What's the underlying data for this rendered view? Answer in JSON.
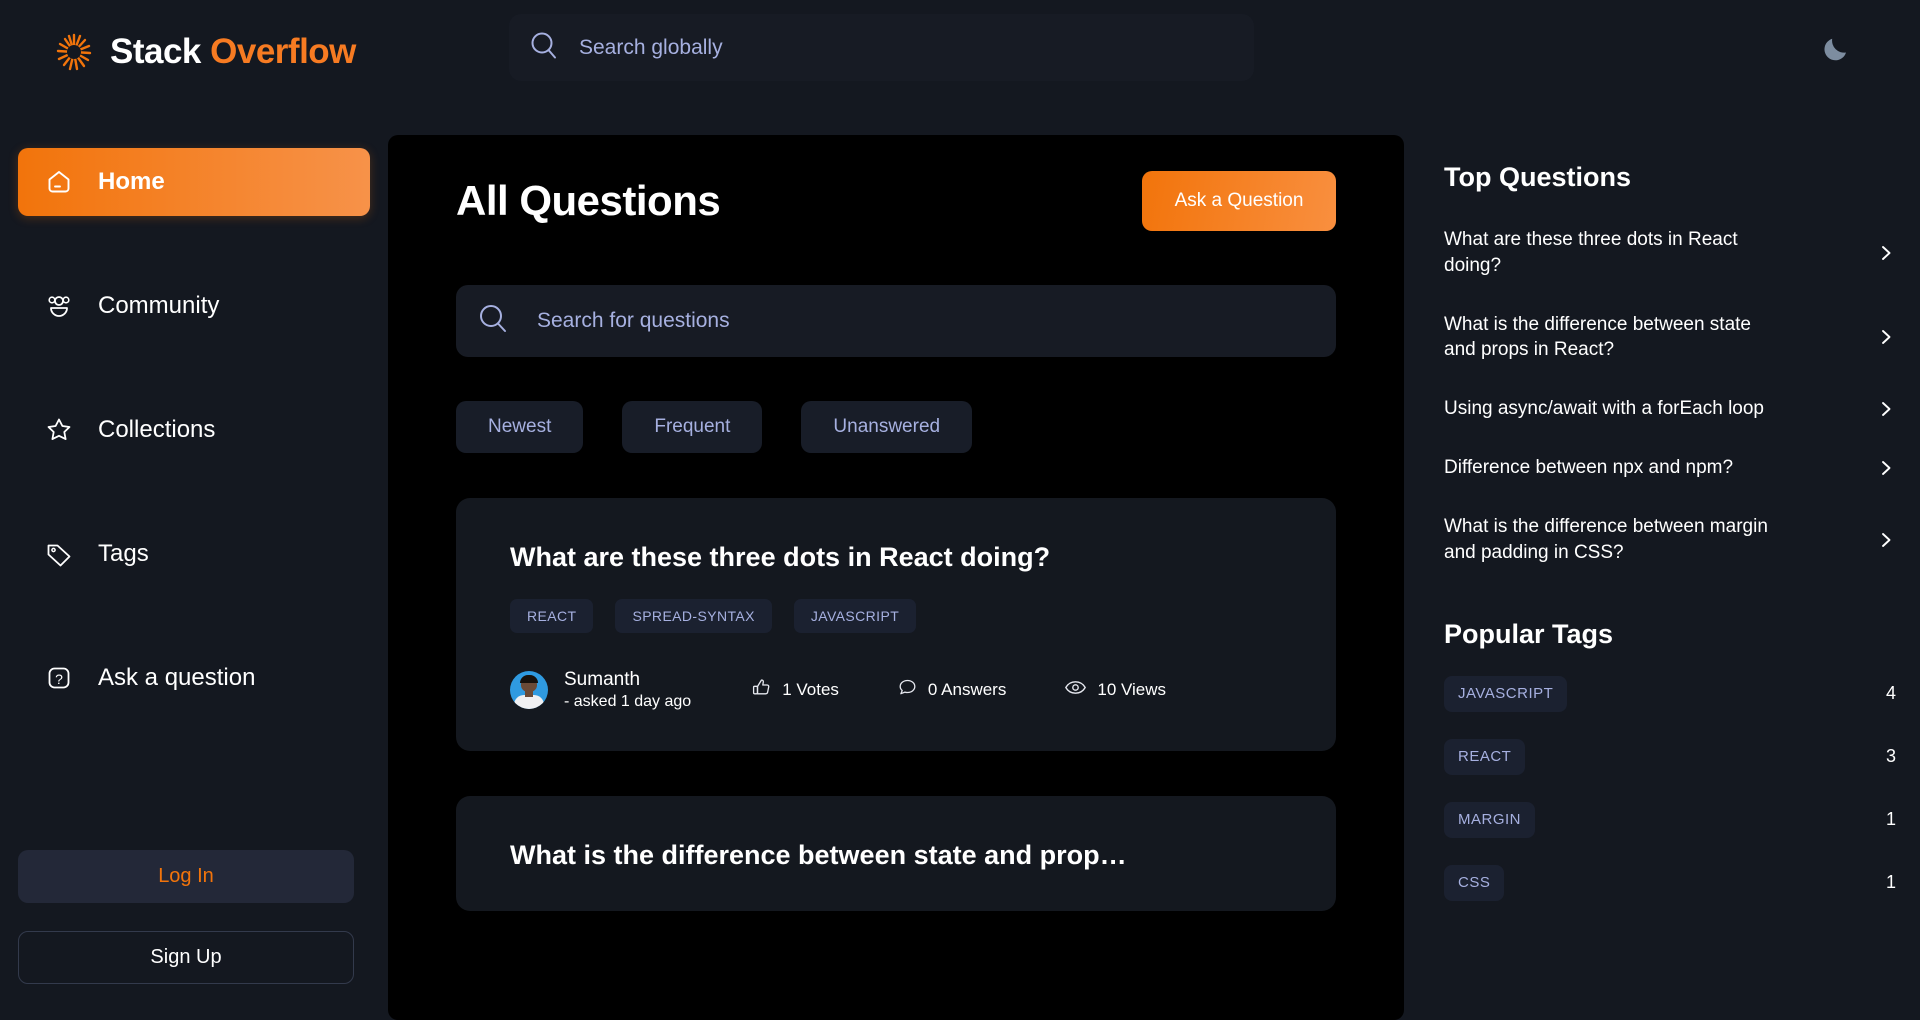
{
  "brand": {
    "name_white": "Stack",
    "name_orange": "Overflow",
    "accent": "#f2740b",
    "logo_icon": "sunburst-icon"
  },
  "header": {
    "search_placeholder": "Search globally",
    "search_icon": "search-icon",
    "theme_toggle_icon": "moon-icon"
  },
  "sidebar": {
    "items": [
      {
        "label": "Home",
        "icon": "home-icon",
        "active": true
      },
      {
        "label": "Community",
        "icon": "people-icon",
        "active": false
      },
      {
        "label": "Collections",
        "icon": "star-icon",
        "active": false
      },
      {
        "label": "Tags",
        "icon": "tag-icon",
        "active": false
      },
      {
        "label": "Ask a question",
        "icon": "question-mark-icon",
        "active": false
      }
    ],
    "login_label": "Log In",
    "signup_label": "Sign Up"
  },
  "main": {
    "title": "All Questions",
    "ask_button": "Ask a Question",
    "search_placeholder": "Search for questions",
    "search_icon": "search-icon",
    "filters": [
      {
        "label": "Newest"
      },
      {
        "label": "Frequent"
      },
      {
        "label": "Unanswered"
      }
    ],
    "questions": [
      {
        "title": "What are these three dots in React doing?",
        "tags": [
          "REACT",
          "SPREAD-SYNTAX",
          "JAVASCRIPT"
        ],
        "author": "Sumanth",
        "asked": "- asked 1 day ago",
        "votes": "1 Votes",
        "answers": "0 Answers",
        "views": "10 Views",
        "votes_icon": "thumbs-up-icon",
        "answers_icon": "comment-icon",
        "views_icon": "eye-icon",
        "avatar_icon": "user-avatar"
      },
      {
        "title": "What is the difference between state and prop…",
        "tags": [],
        "author": "",
        "asked": "",
        "votes": "",
        "answers": "",
        "views": ""
      }
    ]
  },
  "rightbar": {
    "top_questions_title": "Top Questions",
    "top_questions": [
      {
        "text": "What are these three dots in React doing?",
        "chevron": "chevron-right-icon"
      },
      {
        "text": "What is the difference between state and props in React?",
        "chevron": "chevron-right-icon"
      },
      {
        "text": "Using async/await with a forEach loop",
        "chevron": "chevron-right-icon"
      },
      {
        "text": "Difference between npx and npm?",
        "chevron": "chevron-right-icon"
      },
      {
        "text": "What is the difference between margin and padding in CSS?",
        "chevron": "chevron-right-icon"
      }
    ],
    "popular_tags_title": "Popular Tags",
    "popular_tags": [
      {
        "name": "JAVASCRIPT",
        "count": "4"
      },
      {
        "name": "REACT",
        "count": "3"
      },
      {
        "name": "MARGIN",
        "count": "1"
      },
      {
        "name": "CSS",
        "count": "1"
      }
    ]
  }
}
